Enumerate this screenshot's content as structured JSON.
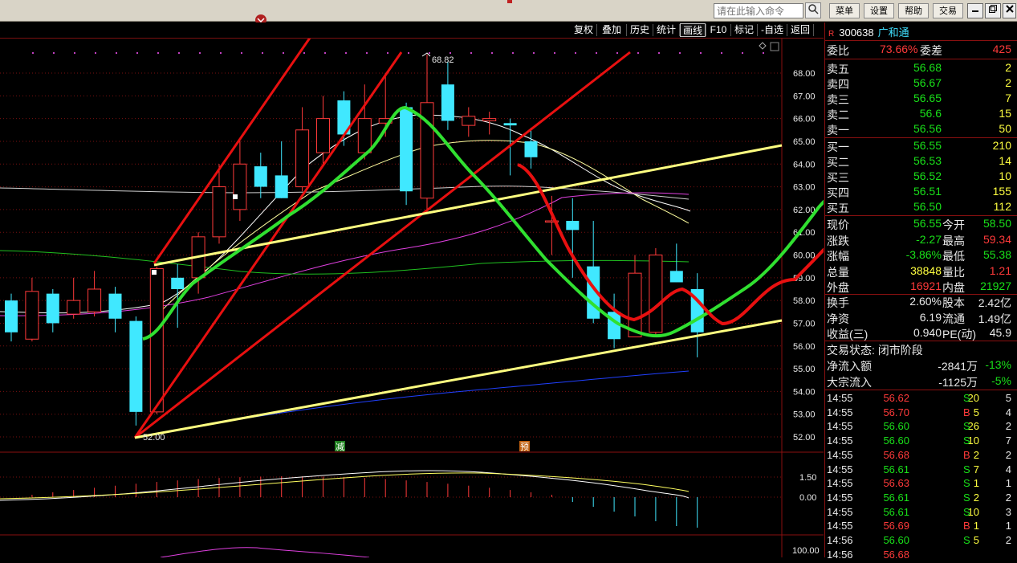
{
  "toolbar": {
    "command_placeholder": "请在此输入命令",
    "search_icon": "search-icon",
    "buttons": [
      "菜单",
      "设置",
      "帮助",
      "交易"
    ],
    "window_controls": [
      "minimize-icon",
      "restore-icon",
      "close-icon"
    ]
  },
  "chart_toolbar": {
    "items": [
      "复权",
      "叠加",
      "历史",
      "统计",
      "画线",
      "F10",
      "标记",
      "-自选",
      "返回"
    ],
    "active": "画线"
  },
  "chart_data": [
    {
      "type": "candlestick",
      "title": "",
      "ylim": [
        51.5,
        69.5
      ],
      "y_ticks": [
        "68.00",
        "67.00",
        "66.00",
        "65.00",
        "64.00",
        "63.00",
        "62.00",
        "61.00",
        "60.00",
        "59.00",
        "58.00",
        "57.00",
        "56.00",
        "55.00",
        "54.00",
        "53.00",
        "52.00"
      ],
      "annotations": {
        "high_label": "68.82",
        "low_label": "52.00",
        "markers": [
          "减",
          "预"
        ]
      },
      "candles": [
        {
          "o": 58.0,
          "h": 58.3,
          "l": 56.2,
          "c": 56.6,
          "up": false
        },
        {
          "o": 56.3,
          "h": 59.0,
          "l": 56.2,
          "c": 58.4,
          "up": true
        },
        {
          "o": 58.3,
          "h": 58.5,
          "l": 56.6,
          "c": 57.0,
          "up": false
        },
        {
          "o": 57.4,
          "h": 59.0,
          "l": 57.2,
          "c": 58.0,
          "up": true
        },
        {
          "o": 57.5,
          "h": 59.3,
          "l": 57.3,
          "c": 58.5,
          "up": true
        },
        {
          "o": 58.3,
          "h": 58.6,
          "l": 56.6,
          "c": 57.2,
          "up": false
        },
        {
          "o": 57.1,
          "h": 57.3,
          "l": 52.5,
          "c": 53.1,
          "up": false
        },
        {
          "o": 53.1,
          "h": 59.5,
          "l": 53.0,
          "c": 59.4,
          "up": true
        },
        {
          "o": 58.5,
          "h": 59.6,
          "l": 56.8,
          "c": 59.0,
          "up": false
        },
        {
          "o": 59.0,
          "h": 61.0,
          "l": 58.3,
          "c": 60.8,
          "up": true
        },
        {
          "o": 60.8,
          "h": 64.0,
          "l": 60.5,
          "c": 63.0,
          "up": true
        },
        {
          "o": 62.0,
          "h": 65.0,
          "l": 61.5,
          "c": 64.0,
          "up": true
        },
        {
          "o": 63.9,
          "h": 64.5,
          "l": 62.5,
          "c": 63.0,
          "up": false
        },
        {
          "o": 63.5,
          "h": 65.0,
          "l": 62.5,
          "c": 62.5,
          "up": false
        },
        {
          "o": 63.0,
          "h": 66.5,
          "l": 62.8,
          "c": 65.5,
          "up": true
        },
        {
          "o": 64.5,
          "h": 67.0,
          "l": 64.0,
          "c": 66.0,
          "up": true
        },
        {
          "o": 66.8,
          "h": 67.2,
          "l": 64.8,
          "c": 65.3,
          "up": false
        },
        {
          "o": 64.5,
          "h": 67.5,
          "l": 64.2,
          "c": 66.0,
          "up": true
        },
        {
          "o": 65.8,
          "h": 68.0,
          "l": 65.2,
          "c": 66.0,
          "up": true
        },
        {
          "o": 66.5,
          "h": 66.7,
          "l": 62.2,
          "c": 62.8,
          "up": false
        },
        {
          "o": 62.5,
          "h": 68.82,
          "l": 61.8,
          "c": 66.7,
          "up": true
        },
        {
          "o": 67.5,
          "h": 68.5,
          "l": 65.5,
          "c": 65.9,
          "up": false
        },
        {
          "o": 65.7,
          "h": 66.5,
          "l": 65.2,
          "c": 66.1,
          "up": true
        },
        {
          "o": 66.0,
          "h": 66.3,
          "l": 65.3,
          "c": 65.9,
          "up": true
        },
        {
          "o": 65.7,
          "h": 66.0,
          "l": 63.5,
          "c": 65.8,
          "up": false
        },
        {
          "o": 65.0,
          "h": 65.6,
          "l": 63.8,
          "c": 64.3,
          "up": false
        },
        {
          "o": 61.5,
          "h": 62.6,
          "l": 60.0,
          "c": 61.5,
          "up": true
        },
        {
          "o": 61.5,
          "h": 62.5,
          "l": 59.0,
          "c": 61.1,
          "up": false
        },
        {
          "o": 59.5,
          "h": 61.5,
          "l": 57.0,
          "c": 57.2,
          "up": false
        },
        {
          "o": 57.5,
          "h": 58.3,
          "l": 55.9,
          "c": 56.3,
          "up": false
        },
        {
          "o": 56.4,
          "h": 60.0,
          "l": 56.4,
          "c": 59.2,
          "up": true
        },
        {
          "o": 56.6,
          "h": 60.3,
          "l": 56.5,
          "c": 60.0,
          "up": true
        },
        {
          "o": 59.3,
          "h": 60.5,
          "l": 58.8,
          "c": 58.8,
          "up": false
        },
        {
          "o": 58.5,
          "h": 59.2,
          "l": 55.5,
          "c": 56.6,
          "up": false
        }
      ]
    },
    {
      "type": "macd",
      "y_ticks": [
        "1.50",
        "0.00"
      ]
    },
    {
      "type": "indicator",
      "y_ticks": [
        "100.00"
      ]
    }
  ],
  "quote": {
    "flag": "R",
    "code": "300638",
    "name": "广和通",
    "weibi_label": "委比",
    "weibi": "73.66%",
    "weicha_label": "委差",
    "weicha": "425",
    "sell": [
      {
        "label": "卖五",
        "price": "56.68",
        "vol": "2"
      },
      {
        "label": "卖四",
        "price": "56.67",
        "vol": "2"
      },
      {
        "label": "卖三",
        "price": "56.65",
        "vol": "7"
      },
      {
        "label": "卖二",
        "price": "56.6",
        "vol": "15"
      },
      {
        "label": "卖一",
        "price": "56.56",
        "vol": "50"
      }
    ],
    "buy": [
      {
        "label": "买一",
        "price": "56.55",
        "vol": "210"
      },
      {
        "label": "买二",
        "price": "56.53",
        "vol": "14"
      },
      {
        "label": "买三",
        "price": "56.52",
        "vol": "10"
      },
      {
        "label": "买四",
        "price": "56.51",
        "vol": "155"
      },
      {
        "label": "买五",
        "price": "56.50",
        "vol": "112"
      }
    ],
    "stats": [
      {
        "l1": "现价",
        "v1": "56.55",
        "c1": "c-g",
        "l2": "今开",
        "v2": "58.50",
        "c2": "c-g"
      },
      {
        "l1": "涨跌",
        "v1": "-2.27",
        "c1": "c-g",
        "l2": "最高",
        "v2": "59.34",
        "c2": "c-r"
      },
      {
        "l1": "涨幅",
        "v1": "-3.86%",
        "c1": "c-g",
        "l2": "最低",
        "v2": "55.38",
        "c2": "c-g"
      },
      {
        "l1": "总量",
        "v1": "38848",
        "c1": "c-y",
        "l2": "量比",
        "v2": "1.21",
        "c2": "c-r"
      },
      {
        "l1": "外盘",
        "v1": "16921",
        "c1": "c-r",
        "l2": "内盘",
        "v2": "21927",
        "c2": "c-g"
      }
    ],
    "stats2": [
      {
        "l1": "换手",
        "v1": "2.60%",
        "l2": "股本",
        "v2": "2.42亿"
      },
      {
        "l1": "净资",
        "v1": "6.19",
        "l2": "流通",
        "v2": "1.49亿"
      },
      {
        "l1": "收益(三)",
        "v1": "0.940",
        "l2": "PE(动)",
        "v2": "45.9"
      }
    ],
    "status": "交易状态: 闭市阶段",
    "flow": [
      {
        "label": "净流入额",
        "value": "-2841万",
        "pct": "-13%"
      },
      {
        "label": "大宗流入",
        "value": "-1125万",
        "pct": "-5%"
      }
    ],
    "trades": [
      {
        "t": "14:55",
        "p": "56.62",
        "v": "20",
        "s": "S",
        "n": "5"
      },
      {
        "t": "14:55",
        "p": "56.70",
        "v": "5",
        "s": "B",
        "n": "4"
      },
      {
        "t": "14:55",
        "p": "56.60",
        "v": "26",
        "s": "S",
        "n": "2"
      },
      {
        "t": "14:55",
        "p": "56.60",
        "v": "10",
        "s": "S",
        "n": "7"
      },
      {
        "t": "14:55",
        "p": "56.68",
        "v": "2",
        "s": "B",
        "n": "2"
      },
      {
        "t": "14:55",
        "p": "56.61",
        "v": "7",
        "s": "S",
        "n": "4"
      },
      {
        "t": "14:55",
        "p": "56.63",
        "v": "1",
        "s": "S",
        "n": "1"
      },
      {
        "t": "14:55",
        "p": "56.61",
        "v": "2",
        "s": "S",
        "n": "2"
      },
      {
        "t": "14:55",
        "p": "56.61",
        "v": "10",
        "s": "S",
        "n": "3"
      },
      {
        "t": "14:55",
        "p": "56.69",
        "v": "1",
        "s": "B",
        "n": "1"
      },
      {
        "t": "14:56",
        "p": "56.60",
        "v": "5",
        "s": "S",
        "n": "2"
      },
      {
        "t": "14:56",
        "p": "56.68",
        "v": "",
        "s": "",
        "n": ""
      }
    ]
  },
  "colors": {
    "up": "#ff3a3a",
    "down": "#40e8ff",
    "ma_white": "#ffffff",
    "ma_yellow": "#ffffa0",
    "ma_magenta": "#e040e0",
    "ma_green": "#20c020",
    "ma_blue": "#2040ff",
    "trend_red": "#e81010",
    "trend_yellow": "#ffff80",
    "draw_green": "#30e030"
  }
}
